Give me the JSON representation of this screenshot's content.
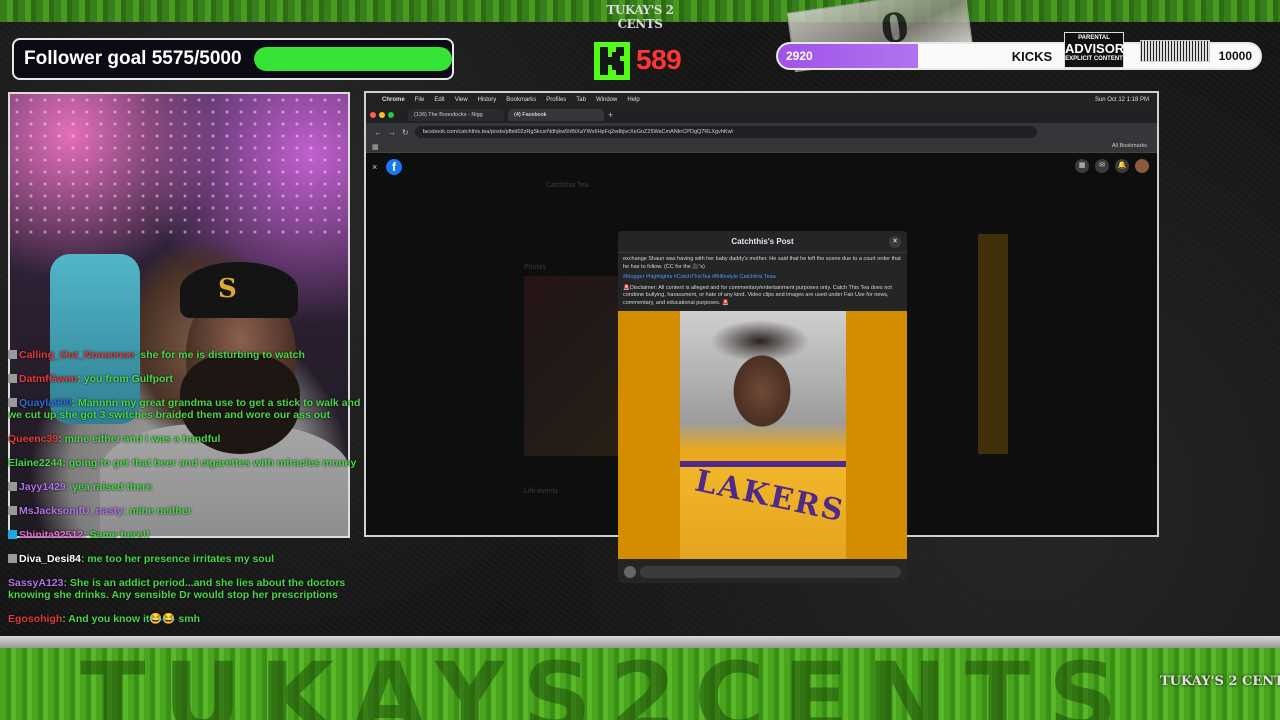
{
  "overlay": {
    "top_logo": "TUKAY'S 2 CENTS",
    "bottom_band_text": "TUKAYS2CENTS",
    "bottom_logo": "TUKAY'S 2 CENTS",
    "money_number": "0"
  },
  "follower_goal": {
    "label": "Follower goal 5575/5000",
    "current": 5575,
    "goal": 5000,
    "fill_fraction": 1.0,
    "bar_color": "#35e335"
  },
  "kick": {
    "logo_letter": "K",
    "logo_color": "#53fc18",
    "count": "589",
    "count_color": "#ff3434"
  },
  "kicks_goal": {
    "start": "2920",
    "label": "KICKS",
    "end": "10000",
    "fill_fraction": 0.29,
    "fill_color": "#9f52e8"
  },
  "parental_advisory": {
    "line1": "PARENTAL",
    "line2": "ADVISORY",
    "line3": "EXPLICIT CONTENT"
  },
  "chat": [
    {
      "user": "Calling_Out_Nonsense",
      "color": "#e23b3b",
      "text": "she for me is disturbing to watch",
      "badge": "gray"
    },
    {
      "user": "DatmfGwen",
      "color": "#e23b3b",
      "text": "you from Gulfport",
      "badge": "gray"
    },
    {
      "user": "Quayla900",
      "color": "#2b6cd6",
      "text": "Mannnn my great grandma use to get a stick to walk and if we cut up she got 3 switches braided them and wore our ass out",
      "badge": "gray"
    },
    {
      "user": "Queenc39",
      "color": "#e23b3b",
      "text": "mine either and i was a handful",
      "badge": ""
    },
    {
      "user": "Elaine2244",
      "color": "#49d649",
      "text": "going to get that beer and cigarettes with miracles money",
      "badge": ""
    },
    {
      "user": "Jayy1429",
      "color": "#b072e6",
      "text": "yea raised there",
      "badge": "gray"
    },
    {
      "user": "MsJacksonifU_nasty",
      "color": "#b072e6",
      "text": "mine neither",
      "badge": "gray"
    },
    {
      "user": "Shinita92512",
      "color": "#e56bd6",
      "text": "Same here!!",
      "badge": "blue"
    },
    {
      "user": "Diva_Desi84",
      "color": "#ffffff",
      "text": "me too her presence irritates my soul",
      "badge": "gray"
    },
    {
      "user": "SassyA123",
      "color": "#b072e6",
      "text": "She is an addict period...and she lies about the doctors knowing she drinks. Any sensible Dr would stop her prescriptions",
      "badge": ""
    },
    {
      "user": "Egosohigh",
      "color": "#e23b3b",
      "text": "And you know it😂😂 smh",
      "badge": ""
    }
  ],
  "chat_text_color": "#49d649",
  "browser": {
    "menubar": {
      "apple": "",
      "items": [
        "Chrome",
        "File",
        "Edit",
        "View",
        "History",
        "Bookmarks",
        "Profiles",
        "Tab",
        "Window",
        "Help"
      ],
      "clock": "Sun Oct 12  1:18 PM"
    },
    "tabs": [
      {
        "label": "(136) The Boondocks - Nigg",
        "active": false
      },
      {
        "label": "(4) Facebook",
        "active": true
      }
    ],
    "url": "facebook.com/catchthis.tea/posts/pfbid02zRgSkcsrNdhjkw5hBiXaYWx6HpFq2edbjvcXeGnZ25WaCmANkrCPDgQ7RLXgvhKwl",
    "all_bookmarks": "All Bookmarks"
  },
  "facebook": {
    "logo": "f",
    "close": "×",
    "dim": {
      "page_name": "Catchthis Tea",
      "photos": "Photos",
      "life_events": "Life events"
    },
    "modal": {
      "title": "Catchthis's Post",
      "close": "×",
      "body": "exchange Shaun was having with her baby daddy's mother. He said that he left the scene due to a court order that he has to follow. (CC for the 🎥's)",
      "tags": "#blogger #highlights #CatchThisTea #fblifestyle Catchthis Teaa",
      "disclaimer": "🚨Disclaimer: All content is alleged and for commentary/entertainment purposes only. Catch This Tea does not condone bullying, harassment, or hate of any kind. Video clips and images are used under Fair Use for news, commentary, and educational purposes. 🚨",
      "jersey_text": "LAKERS"
    }
  }
}
